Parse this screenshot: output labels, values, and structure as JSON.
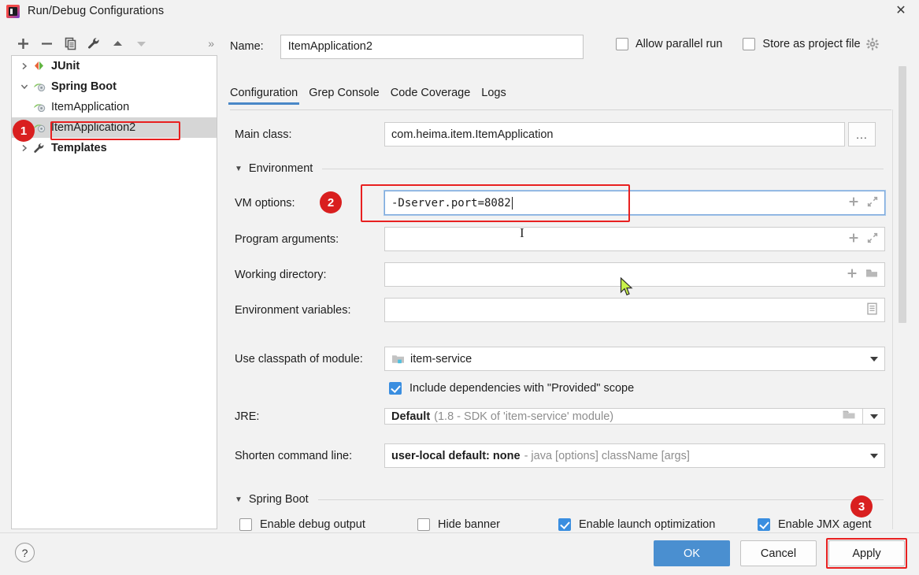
{
  "window": {
    "title": "Run/Debug Configurations",
    "app_icon": "intellij-idea-icon",
    "close_label": "✕"
  },
  "toolbar": {
    "items": [
      {
        "name": "add-configuration-button",
        "icon": "plus-icon",
        "label": "+"
      },
      {
        "name": "remove-configuration-button",
        "icon": "minus-icon",
        "label": "−"
      },
      {
        "name": "copy-configuration-button",
        "icon": "copy-icon",
        "label": "Copy"
      },
      {
        "name": "edit-templates-button",
        "icon": "wrench-icon",
        "label": "Edit Templates"
      },
      {
        "name": "move-up-button",
        "icon": "triangle-up-icon",
        "label": "Move Up"
      },
      {
        "name": "move-down-button",
        "icon": "triangle-down-icon",
        "label": "Move Down"
      }
    ],
    "more_label": "»"
  },
  "tree": {
    "nodes": [
      {
        "label": "JUnit",
        "icon": "junit-icon",
        "expander": "chevron-right-icon",
        "level": 0,
        "bold": true,
        "selected": false
      },
      {
        "label": "Spring Boot",
        "icon": "spring-boot-icon",
        "expander": "chevron-down-icon",
        "level": 0,
        "bold": true,
        "selected": false
      },
      {
        "label": "ItemApplication",
        "icon": "spring-boot-icon",
        "expander": "",
        "level": 1,
        "bold": false,
        "selected": false
      },
      {
        "label": "ItemApplication2",
        "icon": "spring-boot-icon",
        "expander": "",
        "level": 1,
        "bold": false,
        "selected": true
      },
      {
        "label": "Templates",
        "icon": "wrench-icon",
        "expander": "chevron-right-icon",
        "level": 0,
        "bold": true,
        "selected": false
      }
    ]
  },
  "header": {
    "name_label": "Name:",
    "name_value": "ItemApplication2",
    "allow_parallel_run_label": "Allow parallel run",
    "allow_parallel_run_checked": false,
    "store_as_project_file_label": "Store as project file",
    "store_as_project_file_checked": false,
    "gear_icon": "gear-icon"
  },
  "tabs": [
    {
      "label": "Configuration",
      "active": true
    },
    {
      "label": "Grep Console",
      "active": false
    },
    {
      "label": "Code Coverage",
      "active": false
    },
    {
      "label": "Logs",
      "active": false
    }
  ],
  "form": {
    "main_class": {
      "label": "Main class:",
      "value": "com.heima.item.ItemApplication",
      "browse_label": "..."
    },
    "environment_section": {
      "label": "Environment",
      "expander": "triangle-down-icon"
    },
    "vm_options": {
      "label": "VM options:",
      "value": "-Dserver.port=8082",
      "icons": [
        "plus-icon",
        "expand-icon"
      ]
    },
    "program_arguments": {
      "label": "Program arguments:",
      "value": "",
      "icons": [
        "plus-icon",
        "expand-icon"
      ]
    },
    "working_directory": {
      "label": "Working directory:",
      "value": "",
      "icons": [
        "plus-icon",
        "folder-icon"
      ]
    },
    "environment_variables": {
      "label": "Environment variables:",
      "value": "",
      "icons": [
        "list-icon"
      ]
    },
    "use_classpath_of_module": {
      "label": "Use classpath of module:",
      "value": "item-service",
      "module_icon": "module-icon",
      "caret": "chevron-down-icon"
    },
    "include_provided": {
      "label": "Include dependencies with \"Provided\" scope",
      "checked": true
    },
    "jre": {
      "label": "JRE:",
      "value_strong": "Default",
      "value_dim": "(1.8 - SDK of 'item-service' module)",
      "folder_icon": "folder-icon",
      "caret": "chevron-down-icon"
    },
    "shorten_command_line": {
      "label": "Shorten command line:",
      "value_strong": "user-local default: none",
      "value_dim": "- java [options] className [args]",
      "caret": "chevron-down-icon"
    },
    "spring_boot_section": {
      "label": "Spring Boot",
      "expander": "triangle-down-icon"
    },
    "spring_boot_checks": [
      {
        "label": "Enable debug output",
        "checked": false
      },
      {
        "label": "Hide banner",
        "checked": false
      },
      {
        "label": "Enable launch optimization",
        "checked": true
      },
      {
        "label": "Enable JMX agent",
        "checked": true
      }
    ]
  },
  "footer": {
    "help_label": "?",
    "ok_label": "OK",
    "cancel_label": "Cancel",
    "apply_label": "Apply"
  },
  "annotations": {
    "badges": [
      {
        "number": "1",
        "target": "tree-item-itemapplication2"
      },
      {
        "number": "2",
        "target": "vm-options-field"
      },
      {
        "number": "3",
        "target": "apply-button"
      }
    ],
    "highlight_color": "#e82020",
    "badge_color": "#d91f1f"
  },
  "colors": {
    "accent_blue": "#4a8fd0",
    "checkbox_blue": "#3a8ee0",
    "tab_underline": "#4a88c7",
    "selection_gray": "#d6d6d6",
    "dialog_bg": "#f2f2f2"
  }
}
